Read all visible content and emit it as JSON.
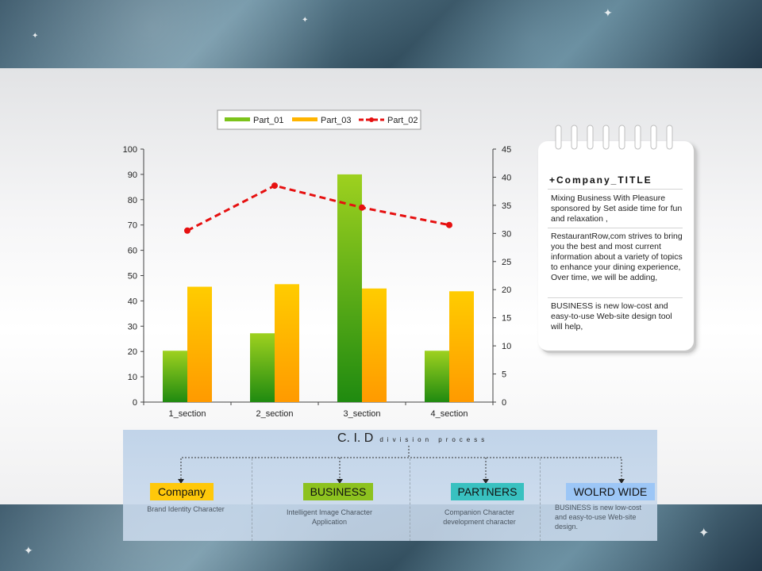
{
  "colors": {
    "part01": "#7cc31b",
    "part03": "#ffb400",
    "part02": "#e61010"
  },
  "chart_data": {
    "type": "bar",
    "categories": [
      "1_section",
      "2_section",
      "3_section",
      "4_section"
    ],
    "series": [
      {
        "name": "Part_01",
        "type": "bar",
        "axis": "left",
        "values": [
          20.3,
          27.2,
          90,
          20.3
        ]
      },
      {
        "name": "Part_03",
        "type": "bar",
        "axis": "left",
        "values": [
          45.6,
          46.6,
          44.9,
          43.8
        ]
      },
      {
        "name": "Part_02",
        "type": "line",
        "axis": "right",
        "values": [
          30.5,
          38.5,
          34.6,
          31.5
        ]
      }
    ],
    "legend": [
      "Part_01",
      "Part_03",
      "Part_02"
    ],
    "ylim": [
      0,
      100
    ],
    "y2lim": [
      0,
      45
    ],
    "yticks": [
      "0",
      "10",
      "20",
      "30",
      "40",
      "50",
      "60",
      "70",
      "80",
      "90",
      "100"
    ],
    "y2ticks": [
      "0",
      "5",
      "10",
      "15",
      "20",
      "25",
      "30",
      "35",
      "40",
      "45"
    ],
    "legend_position": "top"
  },
  "note": {
    "title": "+Company_TITLE",
    "paragraph1": "Mixing Business With Pleasure sponsored by Set aside time for fun and relaxation ,",
    "paragraph2": "RestaurantRow,com strives to bring you the best and most current information about a variety of topics to enhance your dining experience, Over time, we will be adding,",
    "paragraph3": "BUSINESS is new low-cost and easy-to-use Web-site design tool will help,"
  },
  "cid": {
    "title": "C. I. D",
    "subtitle": "division process",
    "boxes": [
      {
        "label": "Company",
        "color": "#ffc80a",
        "desc": "Brand Identity Character"
      },
      {
        "label": "BUSINESS",
        "color": "#8dc21f",
        "desc": "Intelligent Image Character Application"
      },
      {
        "label": "PARTNERS",
        "color": "#39c1c0",
        "desc": "Companion Character development character"
      },
      {
        "label": "WOLRD WIDE",
        "color": "#9cc6f6",
        "desc": "BUSINESS is new low-cost and easy-to-use Web-site design."
      }
    ]
  }
}
